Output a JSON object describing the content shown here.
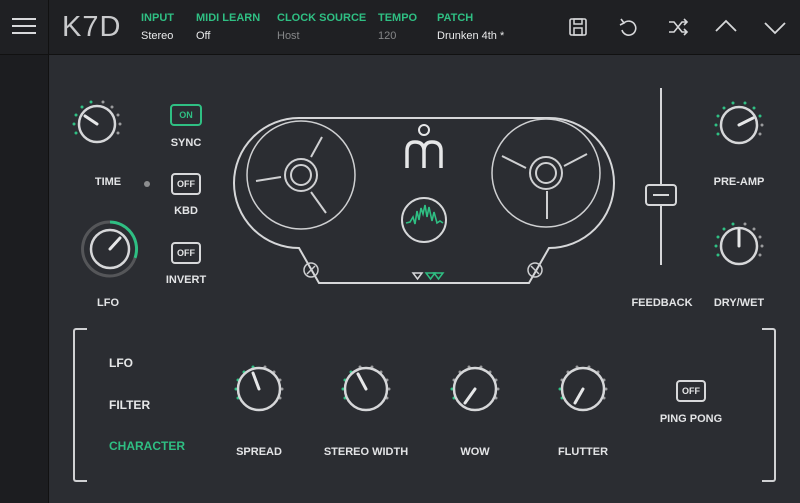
{
  "app": {
    "logo": "K7D"
  },
  "header": {
    "fields": [
      {
        "label": "INPUT",
        "value": "Stereo"
      },
      {
        "label": "MIDI LEARN",
        "value": "Off"
      },
      {
        "label": "CLOCK SOURCE",
        "value": "Host"
      },
      {
        "label": "TEMPO",
        "value": "120"
      },
      {
        "label": "PATCH",
        "value": "Drunken 4th *"
      }
    ],
    "buttons": [
      "menu-icon",
      "save-icon",
      "undo-icon",
      "shuffle-icon",
      "chevron-up-icon",
      "chevron-down-icon"
    ]
  },
  "delay": {
    "time_label": "TIME",
    "lfo_label": "LFO",
    "sync": {
      "state": "ON",
      "label": "SYNC"
    },
    "kbd": {
      "state": "OFF",
      "label": "KBD"
    },
    "invert": {
      "state": "OFF",
      "label": "INVERT"
    }
  },
  "mixer": {
    "feedback_label": "FEEDBACK",
    "preamp_label": "PRE-AMP",
    "drywet_label": "DRY/WET"
  },
  "sections": {
    "items": [
      "LFO",
      "FILTER",
      "CHARACTER"
    ],
    "active": "CHARACTER"
  },
  "character": {
    "spread_label": "SPREAD",
    "stereo_width_label": "STEREO WIDTH",
    "wow_label": "WOW",
    "flutter_label": "FLUTTER",
    "ping_pong": {
      "state": "OFF",
      "label": "PING PONG"
    }
  },
  "colors": {
    "accent": "#2fbf83",
    "panel": "#2b2d32",
    "topbar": "#1f2023",
    "line": "#d6d7d9"
  }
}
